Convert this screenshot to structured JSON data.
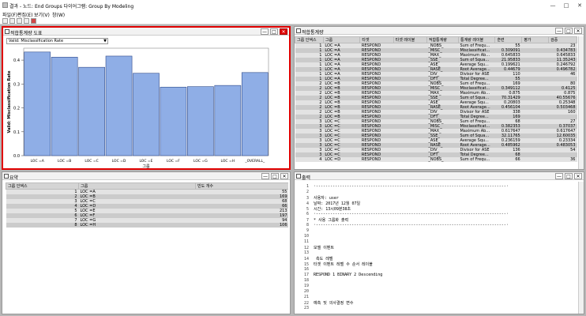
{
  "window": {
    "title": "결과 - 노드: End Groups  다이어그램: Group By Modeling"
  },
  "menu": [
    "파일(F)",
    "편집(E)",
    "보기(V)",
    "창(W)"
  ],
  "chart_pane": {
    "title": "적합통계량 도표",
    "dropdown": "Valid: Misclassification Rate",
    "chart_data": {
      "type": "bar",
      "categories": [
        "LOC =A",
        "LOC =B",
        "LOC =C",
        "LOC =D",
        "LOC =E",
        "LOC =F",
        "LOC =G",
        "LOC =H",
        "_OVERALL_"
      ],
      "values": [
        0.434,
        0.4125,
        0.37,
        0.417,
        0.345,
        0.287,
        0.289,
        0.294,
        0.348
      ],
      "xlabel": "그룹",
      "ylabel": "Valid: Misclassification Rate",
      "ylim": [
        0,
        0.45
      ],
      "yticks": [
        "0.0",
        "0.1",
        "0.2",
        "0.3",
        "0.4"
      ],
      "bar_color": "#8faee6"
    }
  },
  "stats_pane": {
    "title": "적합통계량",
    "columns": [
      "그룹 인덱스",
      "그룹",
      "타겟",
      "타겟 레이블",
      "적합통계량",
      "통계량 레이블",
      "훈련",
      "평가",
      "검증"
    ],
    "rows": [
      [
        "1",
        "LOC =A",
        "RESPOND",
        "",
        "_NOBS_",
        "Sum of Frequ...",
        "55",
        "",
        "23"
      ],
      [
        "1",
        "LOC =A",
        "RESPOND",
        "",
        "_MISC_",
        "Misclassificat...",
        "0.309091",
        "",
        "0.434783"
      ],
      [
        "1",
        "LOC =A",
        "RESPOND",
        "",
        "_MAX_",
        "Maximum Ab...",
        "0.645833",
        "",
        "0.645833"
      ],
      [
        "1",
        "LOC =A",
        "RESPOND",
        "",
        "_SSE_",
        "Sum of Squa...",
        "21.95833",
        "",
        "11.35243"
      ],
      [
        "1",
        "LOC =A",
        "RESPOND",
        "",
        "_ASE_",
        "Average Squ...",
        "0.199621",
        "",
        "0.246792"
      ],
      [
        "1",
        "LOC =A",
        "RESPOND",
        "",
        "_RASE_",
        "Root Average...",
        "0.44679",
        "",
        "0.496782"
      ],
      [
        "1",
        "LOC =A",
        "RESPOND",
        "",
        "_DIV_",
        "Divisor for ASE",
        "110",
        "",
        "46"
      ],
      [
        "1",
        "LOC =A",
        "RESPOND",
        "",
        "_DFT_",
        "Total Degree...",
        "55",
        "",
        ""
      ],
      [
        "2",
        "LOC =B",
        "RESPOND",
        "",
        "_NOBS_",
        "Sum of Frequ...",
        "169",
        "",
        "80"
      ],
      [
        "2",
        "LOC =B",
        "RESPOND",
        "",
        "_MISC_",
        "Misclassificat...",
        "0.349112",
        "",
        "0.4125"
      ],
      [
        "2",
        "LOC =B",
        "RESPOND",
        "",
        "_MAX_",
        "Maximum Ab...",
        "0.875",
        "",
        "0.875"
      ],
      [
        "2",
        "LOC =B",
        "RESPOND",
        "",
        "_SSE_",
        "Sum of Squa...",
        "70.31429",
        "",
        "40.55676"
      ],
      [
        "2",
        "LOC =B",
        "RESPOND",
        "",
        "_ASE_",
        "Average Squ...",
        "0.20803",
        "",
        "0.25348"
      ],
      [
        "2",
        "LOC =B",
        "RESPOND",
        "",
        "_RASE_",
        "Root Average...",
        "0.456104",
        "",
        "0.503468"
      ],
      [
        "2",
        "LOC =B",
        "RESPOND",
        "",
        "_DIV_",
        "Divisor for ASE",
        "338",
        "",
        "160"
      ],
      [
        "2",
        "LOC =B",
        "RESPOND",
        "",
        "_DFT_",
        "Total Degree...",
        "169",
        "",
        ""
      ],
      [
        "3",
        "LOC =C",
        "RESPOND",
        "",
        "_NOBS_",
        "Sum of Frequ...",
        "68",
        "",
        "27"
      ],
      [
        "3",
        "LOC =C",
        "RESPOND",
        "",
        "_MISC_",
        "Misclassificat...",
        "0.382353",
        "",
        "0.37037"
      ],
      [
        "3",
        "LOC =C",
        "RESPOND",
        "",
        "_MAX_",
        "Maximum Ab...",
        "0.617647",
        "",
        "0.617647"
      ],
      [
        "3",
        "LOC =C",
        "RESPOND",
        "",
        "_SSE_",
        "Sum of Squa...",
        "32.11765",
        "",
        "12.60035"
      ],
      [
        "3",
        "LOC =C",
        "RESPOND",
        "",
        "_ASE_",
        "Average Squ...",
        "0.236159",
        "",
        "0.23334"
      ],
      [
        "3",
        "LOC =C",
        "RESPOND",
        "",
        "_RASE_",
        "Root Average...",
        "0.485962",
        "",
        "0.483053"
      ],
      [
        "3",
        "LOC =C",
        "RESPOND",
        "",
        "_DIV_",
        "Divisor for ASE",
        "136",
        "",
        "54"
      ],
      [
        "3",
        "LOC =C",
        "RESPOND",
        "",
        "_DFT_",
        "Total Degree...",
        "68",
        "",
        ""
      ],
      [
        "4",
        "LOC =D",
        "RESPOND",
        "",
        "_NOBS_",
        "Sum of Frequ...",
        "66",
        "",
        "36"
      ]
    ]
  },
  "summary_pane": {
    "title": "요약",
    "columns": [
      "그룹 인덱스",
      "그룹",
      "빈도 개수"
    ],
    "rows": [
      [
        "1",
        "LOC =A",
        "55"
      ],
      [
        "2",
        "LOC =B",
        "169"
      ],
      [
        "3",
        "LOC =C",
        "68"
      ],
      [
        "4",
        "LOC =D",
        "66"
      ],
      [
        "5",
        "LOC =E",
        "213"
      ],
      [
        "6",
        "LOC =F",
        "197"
      ],
      [
        "7",
        "LOC =G",
        "94"
      ],
      [
        "8",
        "LOC =H",
        "106"
      ]
    ]
  },
  "output_pane": {
    "title": "출력",
    "lines": [
      {
        "n": "1",
        "t": "·--------------------------------------------------------------------------------·"
      },
      {
        "n": "2",
        "t": ""
      },
      {
        "n": "3",
        "t": "사용자:                 user"
      },
      {
        "n": "4",
        "t": "날짜:                   2017년 12월 07일"
      },
      {
        "n": "5",
        "t": "시간:                   13시09분38초"
      },
      {
        "n": "6",
        "t": "·--------------------------------------------------------------------------------·"
      },
      {
        "n": "7",
        "t": "* 사용 그룹화 출력"
      },
      {
        "n": "8",
        "t": "·--------------------------------------------------------------------------------·"
      },
      {
        "n": "9",
        "t": ""
      },
      {
        "n": "10",
        "t": ""
      },
      {
        "n": "11",
        "t": ""
      },
      {
        "n": "12",
        "t": "모델 이벤트"
      },
      {
        "n": "13",
        "t": ""
      },
      {
        "n": "14",
        "t": "                        측도        레벨"
      },
      {
        "n": "15",
        "t": "타겟        이벤트        레벨        수        순서        레이블"
      },
      {
        "n": "16",
        "t": ""
      },
      {
        "n": "17",
        "t": "RESPOND      1       BINARY      2     Descending"
      },
      {
        "n": "18",
        "t": ""
      },
      {
        "n": "19",
        "t": ""
      },
      {
        "n": "20",
        "t": ""
      },
      {
        "n": "21",
        "t": ""
      },
      {
        "n": "22",
        "t": "예측 및 의사결정 변수"
      },
      {
        "n": "23",
        "t": ""
      }
    ]
  }
}
